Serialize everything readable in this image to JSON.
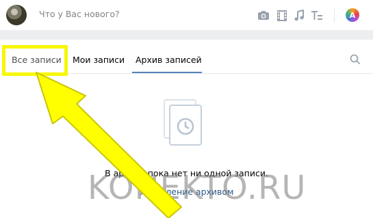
{
  "composer": {
    "placeholder": "Что у Вас нового?",
    "avatar_icon": "hedgehog-avatar",
    "tools": [
      "camera-icon",
      "video-icon",
      "music-icon",
      "text-format-icon"
    ],
    "letter": "A"
  },
  "tabs": {
    "all": "Все записи",
    "mine": "Мои записи",
    "archive": "Архив записей",
    "active": "archive"
  },
  "archive": {
    "empty_message": "В архиве пока нет ни одной записи.",
    "manage_link": "Управление архивом",
    "icon": "archive-clock-icon"
  },
  "watermark": "KONEKTO.RU",
  "colors": {
    "accent": "#5181b8",
    "link": "#2a5885",
    "highlight": "#f7f700"
  }
}
